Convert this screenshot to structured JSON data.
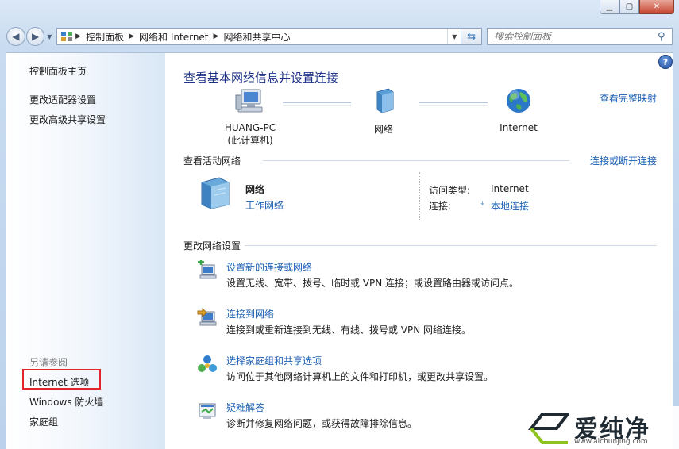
{
  "window": {
    "minimize_icon": "minimize-icon",
    "maximize_icon": "maximize-icon",
    "close_icon": "close-icon"
  },
  "navbar": {
    "breadcrumbs": [
      "控制面板",
      "网络和 Internet",
      "网络和共享中心"
    ],
    "search_placeholder": "搜索控制面板"
  },
  "sidebar": {
    "home": "控制面板主页",
    "items": [
      "更改适配器设置",
      "更改高级共享设置"
    ],
    "see_also_title": "另请参阅",
    "see_also": [
      "Internet 选项",
      "Windows 防火墙",
      "家庭组"
    ]
  },
  "main": {
    "title": "查看基本网络信息并设置连接",
    "full_map_link": "查看完整映射",
    "nodes": [
      {
        "label": "HUANG-PC",
        "sublabel": "(此计算机)"
      },
      {
        "label": "网络",
        "sublabel": ""
      },
      {
        "label": "Internet",
        "sublabel": ""
      }
    ],
    "active_section": {
      "title": "查看活动网络",
      "action": "连接或断开连接",
      "network_name": "网络",
      "network_type": "工作网络",
      "access_type_label": "访问类型:",
      "access_type_value": "Internet",
      "connection_label": "连接:",
      "connection_value": "本地连接"
    },
    "change_section": {
      "title": "更改网络设置",
      "tasks": [
        {
          "link": "设置新的连接或网络",
          "desc": "设置无线、宽带、拨号、临时或 VPN 连接；或设置路由器或访问点。"
        },
        {
          "link": "连接到网络",
          "desc": "连接到或重新连接到无线、有线、拨号或 VPN 网络连接。"
        },
        {
          "link": "选择家庭组和共享选项",
          "desc": "访问位于其他网络计算机上的文件和打印机，或更改共享设置。"
        },
        {
          "link": "疑难解答",
          "desc": "诊断并修复网络问题，或获得故障排除信息。"
        }
      ]
    }
  },
  "watermark": {
    "name": "爱纯净",
    "url": "www.aichunjing.com"
  },
  "colors": {
    "link": "#1a5fb4",
    "title": "#1e3287",
    "highlight_box": "#e3242b"
  }
}
